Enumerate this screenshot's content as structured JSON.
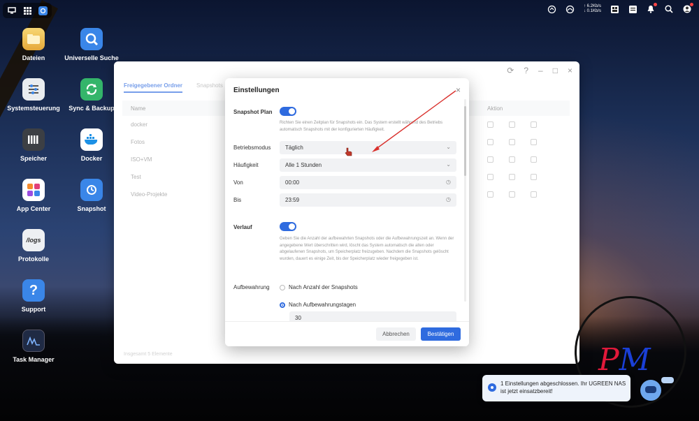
{
  "topbar": {
    "speed_up": "↑ 6.2Kb/s",
    "speed_down": "↓ 0.1Kb/s"
  },
  "desktop": {
    "icons": [
      {
        "label": "Dateien"
      },
      {
        "label": "Universelle Suche"
      },
      {
        "label": "Systemsteuerung"
      },
      {
        "label": "Sync & Backup"
      },
      {
        "label": "Speicher"
      },
      {
        "label": "Docker"
      },
      {
        "label": "App Center"
      },
      {
        "label": "Snapshot"
      },
      {
        "label": "Protokolle"
      },
      {
        "label": "Support"
      },
      {
        "label": "Task Manager"
      }
    ],
    "logs_tile_text": "/logs",
    "support_tile_text": "?"
  },
  "window": {
    "tabs": [
      "Freigegebener Ordner",
      "Snapshots"
    ],
    "columns": {
      "name": "Name",
      "aktion": "Aktion"
    },
    "rows": [
      "docker",
      "Fotos",
      "ISO+VM",
      "Test",
      "Video-Projekte"
    ],
    "footer": "Insgesamt 5 Elemente"
  },
  "dialog": {
    "title": "Einstellungen",
    "snapshot_plan_label": "Snapshot Plan",
    "snapshot_plan_help": "Richten Sie einen Zeitplan für Snapshots ein. Das System erstellt während des Betriebs automatisch Snapshots mit der konfigurierten Häufigkeit.",
    "betriebsmodus_label": "Betriebsmodus",
    "betriebsmodus_value": "Täglich",
    "haeufigkeit_label": "Häufigkeit",
    "haeufigkeit_value": "Alle 1 Stunden",
    "von_label": "Von",
    "von_value": "00:00",
    "bis_label": "Bis",
    "bis_value": "23:59",
    "verlauf_label": "Verlauf",
    "verlauf_help": "Geben Sie die Anzahl der aufbewahrten Snapshots oder die Aufbewahrungszeit an. Wenn der angegebene Wert überschritten wird, löscht das System automatisch die alten oder abgelaufenen Snapshots, um Speicherplatz freizugeben. Nachdem die Snapshots gelöscht wurden, dauert es einige Zeit, bis der Speicherplatz wieder freigegeben ist.",
    "aufbewahrung_label": "Aufbewahrung",
    "option_count": "Nach Anzahl der Snapshots",
    "option_days": "Nach Aufbewahrungstagen",
    "days_value": "30",
    "cancel": "Abbrechen",
    "confirm": "Bestätigen"
  },
  "toast": {
    "text": "1 Einstellungen abgeschlossen. Ihr UGREEN NAS ist jetzt einsatzbereit!"
  },
  "watermark": {
    "p": "P",
    "m": "M"
  },
  "colors": {
    "accent": "#2f6bdf",
    "arrow": "#d9302c"
  }
}
